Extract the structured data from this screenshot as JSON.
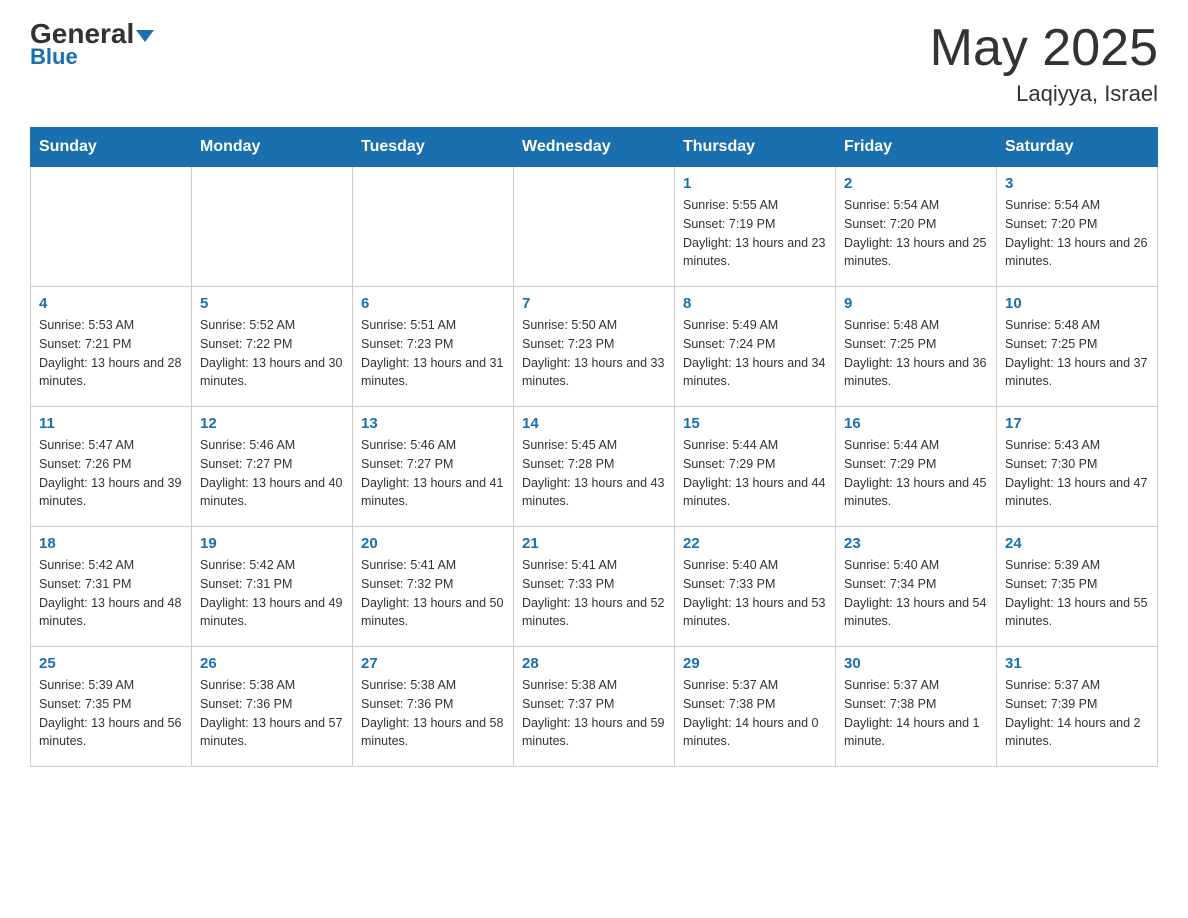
{
  "header": {
    "logo_general": "General",
    "logo_blue": "Blue",
    "month_title": "May 2025",
    "location": "Laqiyya, Israel"
  },
  "weekdays": [
    "Sunday",
    "Monday",
    "Tuesday",
    "Wednesday",
    "Thursday",
    "Friday",
    "Saturday"
  ],
  "weeks": [
    [
      {
        "day": "",
        "sunrise": "",
        "sunset": "",
        "daylight": ""
      },
      {
        "day": "",
        "sunrise": "",
        "sunset": "",
        "daylight": ""
      },
      {
        "day": "",
        "sunrise": "",
        "sunset": "",
        "daylight": ""
      },
      {
        "day": "",
        "sunrise": "",
        "sunset": "",
        "daylight": ""
      },
      {
        "day": "1",
        "sunrise": "Sunrise: 5:55 AM",
        "sunset": "Sunset: 7:19 PM",
        "daylight": "Daylight: 13 hours and 23 minutes."
      },
      {
        "day": "2",
        "sunrise": "Sunrise: 5:54 AM",
        "sunset": "Sunset: 7:20 PM",
        "daylight": "Daylight: 13 hours and 25 minutes."
      },
      {
        "day": "3",
        "sunrise": "Sunrise: 5:54 AM",
        "sunset": "Sunset: 7:20 PM",
        "daylight": "Daylight: 13 hours and 26 minutes."
      }
    ],
    [
      {
        "day": "4",
        "sunrise": "Sunrise: 5:53 AM",
        "sunset": "Sunset: 7:21 PM",
        "daylight": "Daylight: 13 hours and 28 minutes."
      },
      {
        "day": "5",
        "sunrise": "Sunrise: 5:52 AM",
        "sunset": "Sunset: 7:22 PM",
        "daylight": "Daylight: 13 hours and 30 minutes."
      },
      {
        "day": "6",
        "sunrise": "Sunrise: 5:51 AM",
        "sunset": "Sunset: 7:23 PM",
        "daylight": "Daylight: 13 hours and 31 minutes."
      },
      {
        "day": "7",
        "sunrise": "Sunrise: 5:50 AM",
        "sunset": "Sunset: 7:23 PM",
        "daylight": "Daylight: 13 hours and 33 minutes."
      },
      {
        "day": "8",
        "sunrise": "Sunrise: 5:49 AM",
        "sunset": "Sunset: 7:24 PM",
        "daylight": "Daylight: 13 hours and 34 minutes."
      },
      {
        "day": "9",
        "sunrise": "Sunrise: 5:48 AM",
        "sunset": "Sunset: 7:25 PM",
        "daylight": "Daylight: 13 hours and 36 minutes."
      },
      {
        "day": "10",
        "sunrise": "Sunrise: 5:48 AM",
        "sunset": "Sunset: 7:25 PM",
        "daylight": "Daylight: 13 hours and 37 minutes."
      }
    ],
    [
      {
        "day": "11",
        "sunrise": "Sunrise: 5:47 AM",
        "sunset": "Sunset: 7:26 PM",
        "daylight": "Daylight: 13 hours and 39 minutes."
      },
      {
        "day": "12",
        "sunrise": "Sunrise: 5:46 AM",
        "sunset": "Sunset: 7:27 PM",
        "daylight": "Daylight: 13 hours and 40 minutes."
      },
      {
        "day": "13",
        "sunrise": "Sunrise: 5:46 AM",
        "sunset": "Sunset: 7:27 PM",
        "daylight": "Daylight: 13 hours and 41 minutes."
      },
      {
        "day": "14",
        "sunrise": "Sunrise: 5:45 AM",
        "sunset": "Sunset: 7:28 PM",
        "daylight": "Daylight: 13 hours and 43 minutes."
      },
      {
        "day": "15",
        "sunrise": "Sunrise: 5:44 AM",
        "sunset": "Sunset: 7:29 PM",
        "daylight": "Daylight: 13 hours and 44 minutes."
      },
      {
        "day": "16",
        "sunrise": "Sunrise: 5:44 AM",
        "sunset": "Sunset: 7:29 PM",
        "daylight": "Daylight: 13 hours and 45 minutes."
      },
      {
        "day": "17",
        "sunrise": "Sunrise: 5:43 AM",
        "sunset": "Sunset: 7:30 PM",
        "daylight": "Daylight: 13 hours and 47 minutes."
      }
    ],
    [
      {
        "day": "18",
        "sunrise": "Sunrise: 5:42 AM",
        "sunset": "Sunset: 7:31 PM",
        "daylight": "Daylight: 13 hours and 48 minutes."
      },
      {
        "day": "19",
        "sunrise": "Sunrise: 5:42 AM",
        "sunset": "Sunset: 7:31 PM",
        "daylight": "Daylight: 13 hours and 49 minutes."
      },
      {
        "day": "20",
        "sunrise": "Sunrise: 5:41 AM",
        "sunset": "Sunset: 7:32 PM",
        "daylight": "Daylight: 13 hours and 50 minutes."
      },
      {
        "day": "21",
        "sunrise": "Sunrise: 5:41 AM",
        "sunset": "Sunset: 7:33 PM",
        "daylight": "Daylight: 13 hours and 52 minutes."
      },
      {
        "day": "22",
        "sunrise": "Sunrise: 5:40 AM",
        "sunset": "Sunset: 7:33 PM",
        "daylight": "Daylight: 13 hours and 53 minutes."
      },
      {
        "day": "23",
        "sunrise": "Sunrise: 5:40 AM",
        "sunset": "Sunset: 7:34 PM",
        "daylight": "Daylight: 13 hours and 54 minutes."
      },
      {
        "day": "24",
        "sunrise": "Sunrise: 5:39 AM",
        "sunset": "Sunset: 7:35 PM",
        "daylight": "Daylight: 13 hours and 55 minutes."
      }
    ],
    [
      {
        "day": "25",
        "sunrise": "Sunrise: 5:39 AM",
        "sunset": "Sunset: 7:35 PM",
        "daylight": "Daylight: 13 hours and 56 minutes."
      },
      {
        "day": "26",
        "sunrise": "Sunrise: 5:38 AM",
        "sunset": "Sunset: 7:36 PM",
        "daylight": "Daylight: 13 hours and 57 minutes."
      },
      {
        "day": "27",
        "sunrise": "Sunrise: 5:38 AM",
        "sunset": "Sunset: 7:36 PM",
        "daylight": "Daylight: 13 hours and 58 minutes."
      },
      {
        "day": "28",
        "sunrise": "Sunrise: 5:38 AM",
        "sunset": "Sunset: 7:37 PM",
        "daylight": "Daylight: 13 hours and 59 minutes."
      },
      {
        "day": "29",
        "sunrise": "Sunrise: 5:37 AM",
        "sunset": "Sunset: 7:38 PM",
        "daylight": "Daylight: 14 hours and 0 minutes."
      },
      {
        "day": "30",
        "sunrise": "Sunrise: 5:37 AM",
        "sunset": "Sunset: 7:38 PM",
        "daylight": "Daylight: 14 hours and 1 minute."
      },
      {
        "day": "31",
        "sunrise": "Sunrise: 5:37 AM",
        "sunset": "Sunset: 7:39 PM",
        "daylight": "Daylight: 14 hours and 2 minutes."
      }
    ]
  ]
}
